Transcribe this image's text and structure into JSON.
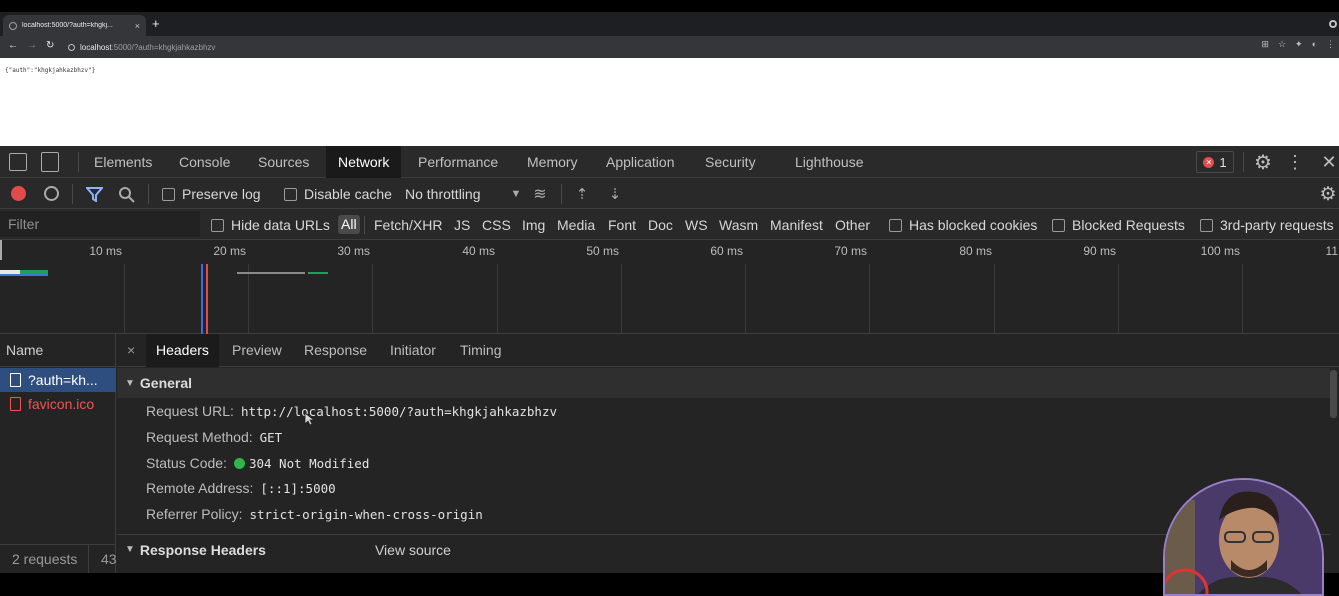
{
  "browser": {
    "tab_title": "localhost:5000/?auth=khgkj...",
    "url_host": "localhost",
    "url_rest": ":5000/?auth=khgkjahkazbhzv",
    "new_tab": "+",
    "tab_close": "×"
  },
  "page": {
    "json_text": "{\"auth\":\"khgkjahkazbhzv\"}"
  },
  "devtools": {
    "tabs": [
      "Elements",
      "Console",
      "Sources",
      "Network",
      "Performance",
      "Memory",
      "Application",
      "Security",
      "Lighthouse"
    ],
    "active_tab": "Network",
    "error_count": "1",
    "toolbar": {
      "preserve_log": "Preserve log",
      "disable_cache": "Disable cache",
      "throttling": "No throttling"
    },
    "filter": {
      "placeholder": "Filter",
      "hide_data_urls": "Hide data URLs",
      "types": [
        "All",
        "Fetch/XHR",
        "JS",
        "CSS",
        "Img",
        "Media",
        "Font",
        "Doc",
        "WS",
        "Wasm",
        "Manifest",
        "Other"
      ],
      "selected_type": "All",
      "has_blocked_cookies": "Has blocked cookies",
      "blocked_requests": "Blocked Requests",
      "third_party": "3rd-party requests"
    },
    "timeline": {
      "ticks": [
        "10 ms",
        "20 ms",
        "30 ms",
        "40 ms",
        "50 ms",
        "60 ms",
        "70 ms",
        "80 ms",
        "90 ms",
        "100 ms",
        "11"
      ]
    },
    "requests": {
      "header": "Name",
      "rows": [
        {
          "name": "?auth=kh...",
          "status": "selected"
        },
        {
          "name": "favicon.ico",
          "status": "error"
        }
      ],
      "footer": "2 requests",
      "footer_extra": "43"
    },
    "detail": {
      "close": "×",
      "tabs": [
        "Headers",
        "Preview",
        "Response",
        "Initiator",
        "Timing"
      ],
      "active_tab": "Headers",
      "general_title": "General",
      "fields": [
        {
          "key": "Request URL:",
          "value": "http://localhost:5000/?auth=khgkjahkazbhzv"
        },
        {
          "key": "Request Method:",
          "value": "GET"
        },
        {
          "key": "Status Code:",
          "value": "304 Not Modified"
        },
        {
          "key": "Remote Address:",
          "value": "[::1]:5000"
        },
        {
          "key": "Referrer Policy:",
          "value": "strict-origin-when-cross-origin"
        }
      ],
      "response_headers_title": "Response Headers",
      "view_source": "View source"
    }
  },
  "colors": {
    "status_ok": "#2fb54a",
    "record": "#e34b4b",
    "selected_row": "#2f4e80",
    "error_text": "#f55252"
  }
}
